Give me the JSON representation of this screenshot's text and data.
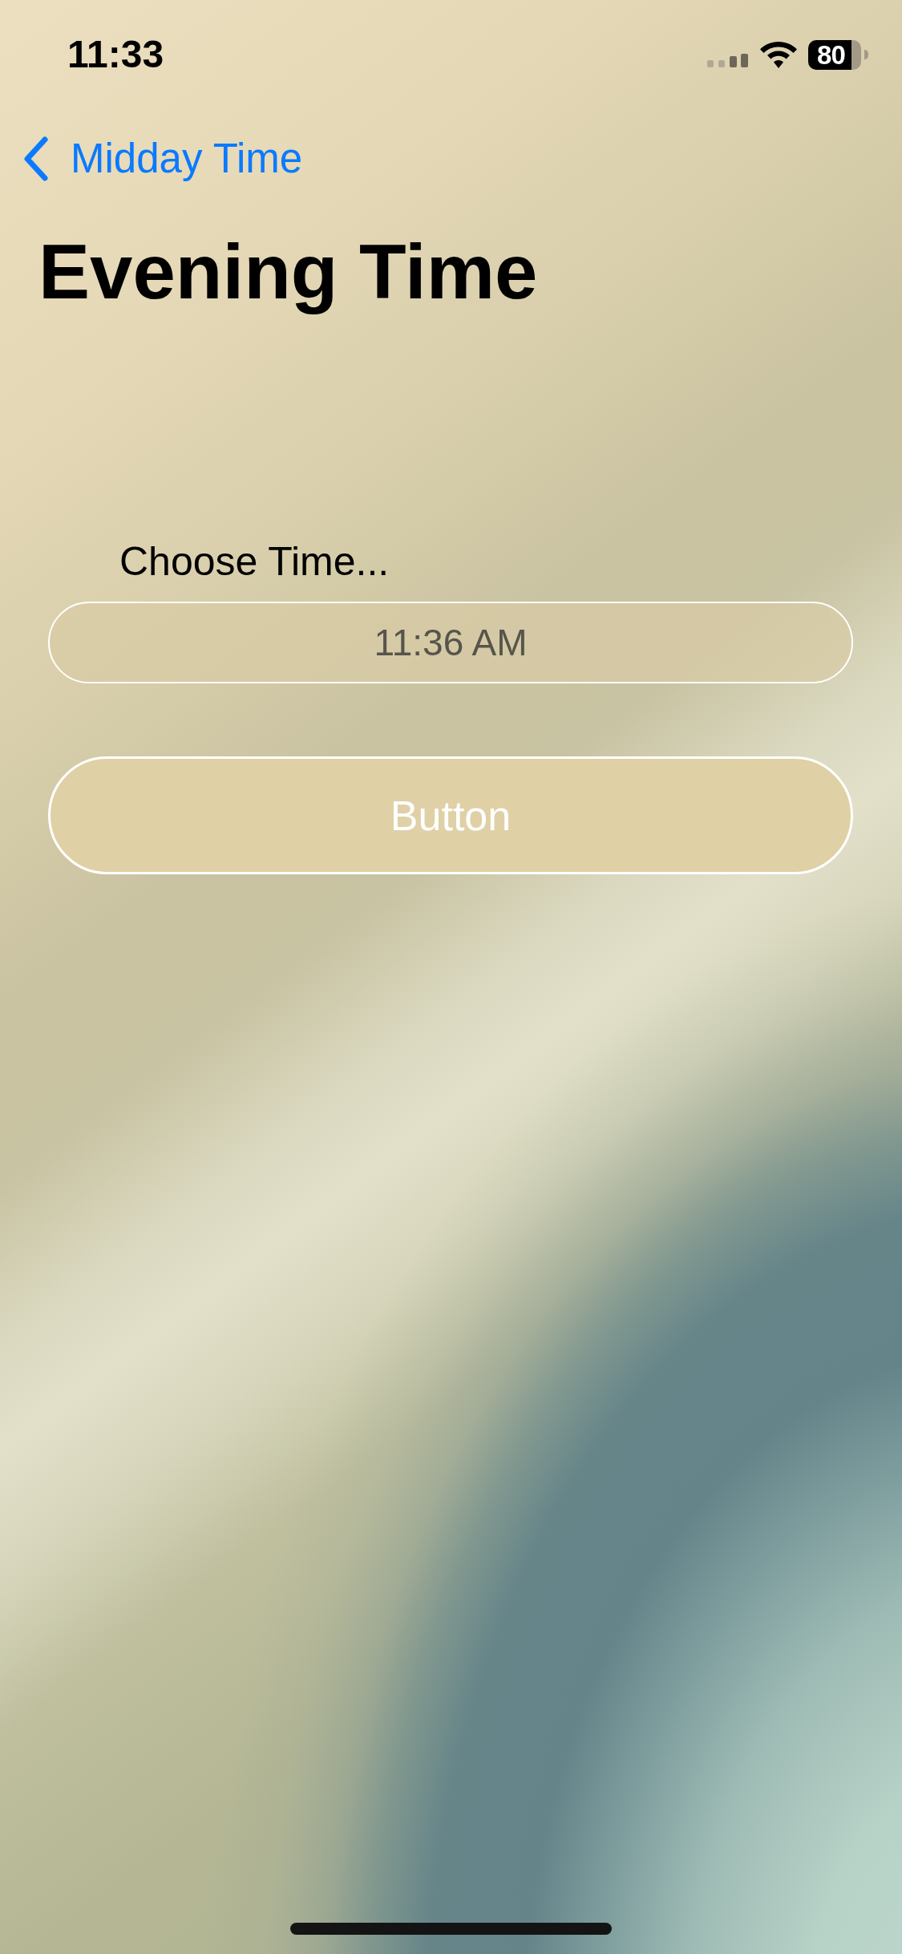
{
  "status_bar": {
    "time": "11:33",
    "battery": "80"
  },
  "navigation": {
    "back_label": "Midday Time",
    "title": "Evening Time"
  },
  "form": {
    "label": "Choose Time...",
    "time_field": {
      "value": "11:36 AM"
    },
    "button": "Button"
  }
}
